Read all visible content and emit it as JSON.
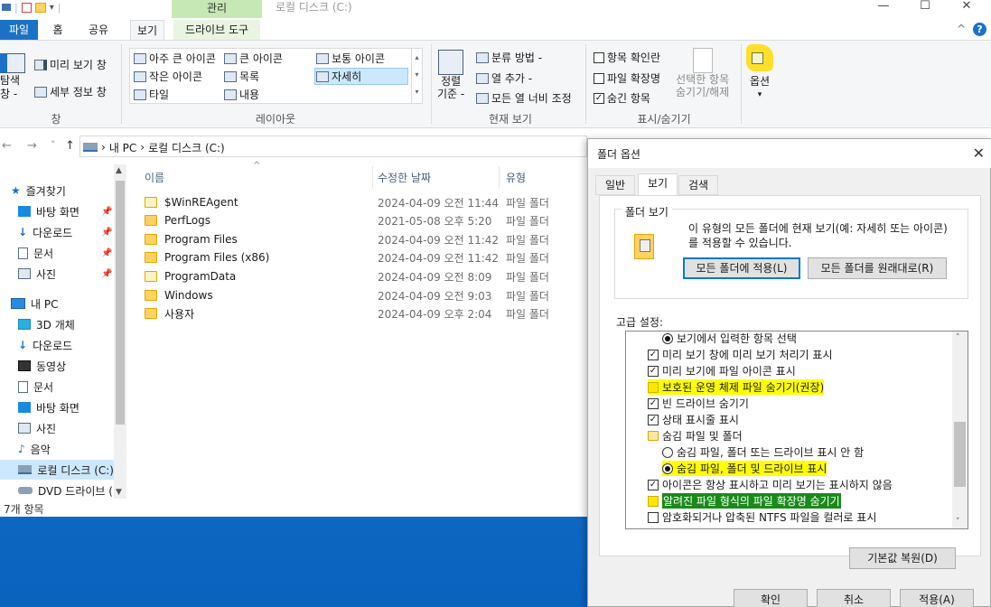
{
  "explorer": {
    "title_path": "로컬 디스크 (C:)",
    "context_tab": "관리",
    "window_controls": {
      "minimize": "—",
      "maximize": "☐",
      "close": "✕"
    },
    "tabs": {
      "file": "파일",
      "home": "홈",
      "share": "공유",
      "view": "보기",
      "drive_tools": "드라이브 도구"
    },
    "ribbon_collapse": "^",
    "help": "?",
    "ribbon": {
      "pane": {
        "preview": "미리 보기 창",
        "details": "세부 정보 창",
        "nav_a": "탐색",
        "nav_b": "창 -",
        "group": "창"
      },
      "layout": {
        "xl_icons": "아주 큰 아이콘",
        "l_icons": "큰 아이콘",
        "m_icons": "보통 아이콘",
        "s_icons": "작은 아이콘",
        "list": "목록",
        "details": "자세히",
        "tiles": "타일",
        "content": "내용",
        "group": "레이아웃"
      },
      "current_view": {
        "sort_a": "정렬",
        "sort_b": "기준 -",
        "group_by": "분류 방법 -",
        "add_col": "열 추가 -",
        "fit_cols": "모든 열 너비 조정",
        "group": "현재 보기"
      },
      "show_hide": {
        "item_checkbox": "항목 확인란",
        "extensions": "파일 확장명",
        "hidden": "숨긴 항목",
        "hide_sel_a": "선택한 항목",
        "hide_sel_b": "숨기기/해제",
        "group": "표시/숨기기"
      },
      "options": "옵션"
    },
    "address": {
      "back": "←",
      "forward": "→",
      "recent": "˅",
      "up": "↑",
      "crumbs": [
        "내 PC",
        "로컬 디스크 (C:)"
      ]
    },
    "nav_pane": [
      {
        "label": "즐겨찾기",
        "icon": "star-icon"
      },
      {
        "label": "바탕 화면",
        "icon": "desktop-icon",
        "pinned": true
      },
      {
        "label": "다운로드",
        "icon": "download-icon",
        "pinned": true
      },
      {
        "label": "문서",
        "icon": "document-icon",
        "pinned": true
      },
      {
        "label": "사진",
        "icon": "pictures-icon",
        "pinned": true
      },
      {
        "label": "내 PC",
        "icon": "pc-icon"
      },
      {
        "label": "3D 개체",
        "icon": "3d-icon"
      },
      {
        "label": "다운로드",
        "icon": "download-icon"
      },
      {
        "label": "동영상",
        "icon": "video-icon"
      },
      {
        "label": "문서",
        "icon": "document-icon"
      },
      {
        "label": "바탕 화면",
        "icon": "desktop-icon"
      },
      {
        "label": "사진",
        "icon": "pictures-icon"
      },
      {
        "label": "음악",
        "icon": "music-icon"
      },
      {
        "label": "로컬 디스크 (C:)",
        "icon": "drive-icon"
      },
      {
        "label": "DVD 드라이브 (",
        "icon": "dvd-icon"
      }
    ],
    "columns": {
      "name": "이름",
      "date": "수정한 날짜",
      "type": "유형"
    },
    "files": [
      {
        "name": "$WinREAgent",
        "date": "2024-04-09 오전 11:44",
        "type": "파일 폴더"
      },
      {
        "name": "PerfLogs",
        "date": "2021-05-08 오후 5:20",
        "type": "파일 폴더"
      },
      {
        "name": "Program Files",
        "date": "2024-04-09 오전 11:42",
        "type": "파일 폴더"
      },
      {
        "name": "Program Files (x86)",
        "date": "2024-04-09 오전 11:42",
        "type": "파일 폴더"
      },
      {
        "name": "ProgramData",
        "date": "2024-04-09 오전 8:09",
        "type": "파일 폴더"
      },
      {
        "name": "Windows",
        "date": "2024-04-09 오전 9:03",
        "type": "파일 폴더"
      },
      {
        "name": "사용자",
        "date": "2024-04-09 오후 2:04",
        "type": "파일 폴더"
      }
    ],
    "status": "7개 항목"
  },
  "dialog": {
    "title": "폴더 옵션",
    "close": "✕",
    "tabs": [
      "일반",
      "보기",
      "검색"
    ],
    "folder_view": {
      "label": "폴더 보기",
      "desc": "이 유형의 모든 폴더에 현재 보기(예: 자세히 또는 아이콘)를 적용할 수 있습니다.",
      "apply_all": "모든 폴더에 적용(L)",
      "reset_all": "모든 폴더를 원래대로(R)"
    },
    "advanced_label": "고급 설정:",
    "advanced": [
      {
        "kind": "radio",
        "on": true,
        "label": "보기에서 입력한 항목 선택",
        "hl": "",
        "indent": 1
      },
      {
        "kind": "check",
        "on": true,
        "label": "미리 보기 창에 미리 보기 처리기 표시",
        "hl": "",
        "indent": 0
      },
      {
        "kind": "check",
        "on": true,
        "label": "미리 보기에 파일 아이콘 표시",
        "hl": "",
        "indent": 0
      },
      {
        "kind": "check",
        "on": false,
        "label": "보호된 운영 체제 파일 숨기기(권장)",
        "hl": "yellow",
        "indent": 0
      },
      {
        "kind": "check",
        "on": true,
        "label": "빈 드라이브 숨기기",
        "hl": "",
        "indent": 0
      },
      {
        "kind": "check",
        "on": true,
        "label": "상태 표시줄 표시",
        "hl": "",
        "indent": 0
      },
      {
        "kind": "folder",
        "on": false,
        "label": "숨김 파일 및 폴더",
        "hl": "",
        "indent": 0
      },
      {
        "kind": "radio",
        "on": false,
        "label": "숨김 파일, 폴더 또는 드라이브 표시 안 함",
        "hl": "",
        "indent": 1
      },
      {
        "kind": "radio",
        "on": true,
        "label": "숨김 파일, 폴더 및 드라이브 표시",
        "hl": "yellow",
        "indent": 1
      },
      {
        "kind": "check",
        "on": true,
        "label": "아이콘은 항상 표시하고 미리 보기는 표시하지 않음",
        "hl": "",
        "indent": 0
      },
      {
        "kind": "check",
        "on": false,
        "label": "알려진 파일 형식의 파일 확장명 숨기기",
        "hl": "green",
        "indent": 0
      },
      {
        "kind": "check",
        "on": false,
        "label": "암호화되거나 압축된 NTFS 파일을 컬러로 표시",
        "hl": "",
        "indent": 0
      }
    ],
    "restore_defaults": "기본값 복원(D)",
    "ok": "확인",
    "cancel": "취소",
    "apply": "적용(A)"
  }
}
